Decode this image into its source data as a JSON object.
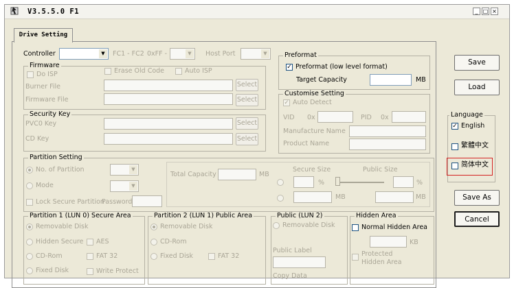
{
  "window": {
    "title": "V3.5.5.0 F1",
    "controls": {
      "minimize": "_",
      "maximize": "□",
      "close": "×"
    }
  },
  "tab": {
    "label": "Drive Setting"
  },
  "controller": {
    "label": "Controller",
    "value": "",
    "fc_label": "FC1 - FC2",
    "ff_label": "0xFF -",
    "host_port_label": "Host Port"
  },
  "firmware": {
    "title": "Firmware",
    "do_isp": "Do ISP",
    "erase_old_code": "Erase Old Code",
    "auto_isp": "Auto ISP",
    "burner_file": "Burner File",
    "firmware_file": "Firmware File",
    "select": "Select"
  },
  "security_key": {
    "title": "Security Key",
    "pvc0_key": "PVC0 Key",
    "cd_key": "CD Key",
    "select": "Select"
  },
  "partition_setting": {
    "title": "Partition Setting",
    "no_of_partition": "No. of Partition",
    "mode": "Mode",
    "lock_secure_partition": "Lock Secure Partition",
    "password": "Password",
    "total_capacity": "Total Capacity",
    "mb": "MB",
    "secure_size": "Secure Size",
    "public_size": "Public Size",
    "percent": "%"
  },
  "partition1": {
    "title": "Partition 1 (LUN 0) Secure Area",
    "removable_disk": "Removable Disk",
    "hidden_secure": "Hidden Secure",
    "aes": "AES",
    "cd_rom": "CD-Rom",
    "fat32": "FAT 32",
    "fixed_disk": "Fixed Disk",
    "write_protect": "Write Protect"
  },
  "partition2": {
    "title": "Partition 2 (LUN 1) Public Area",
    "removable_disk": "Removable Disk",
    "cd_rom": "CD-Rom",
    "fixed_disk": "Fixed Disk",
    "fat32": "FAT 32"
  },
  "public_lun2": {
    "title": "Public (LUN 2)",
    "removable_disk": "Removable Disk",
    "public_label": "Public Label",
    "extra_label": "Copy Data"
  },
  "hidden_area": {
    "title": "Hidden Area",
    "normal_hidden_area": "Normal Hidden Area",
    "kb": "KB",
    "protected_hidden_area": "Protected Hidden Area"
  },
  "preformat": {
    "title": "Preformat",
    "checkbox_label": "Preformat (low level format)",
    "checked": true,
    "target_capacity": "Target Capacity",
    "target_value": "",
    "mb": "MB"
  },
  "customise": {
    "title": "Customise Setting",
    "auto_detect": "Auto Detect",
    "vid": "VID",
    "hex": "0x",
    "pid": "PID",
    "manufacture_name": "Manufacture Name",
    "product_name": "Product Name"
  },
  "buttons": {
    "save": "Save",
    "load": "Load",
    "save_as": "Save As",
    "cancel": "Cancel"
  },
  "language": {
    "title": "Language",
    "english": "English",
    "traditional_chinese": "繁體中文",
    "simplified_chinese": "简体中文",
    "english_checked": true,
    "highlight_color": "#d42020"
  }
}
